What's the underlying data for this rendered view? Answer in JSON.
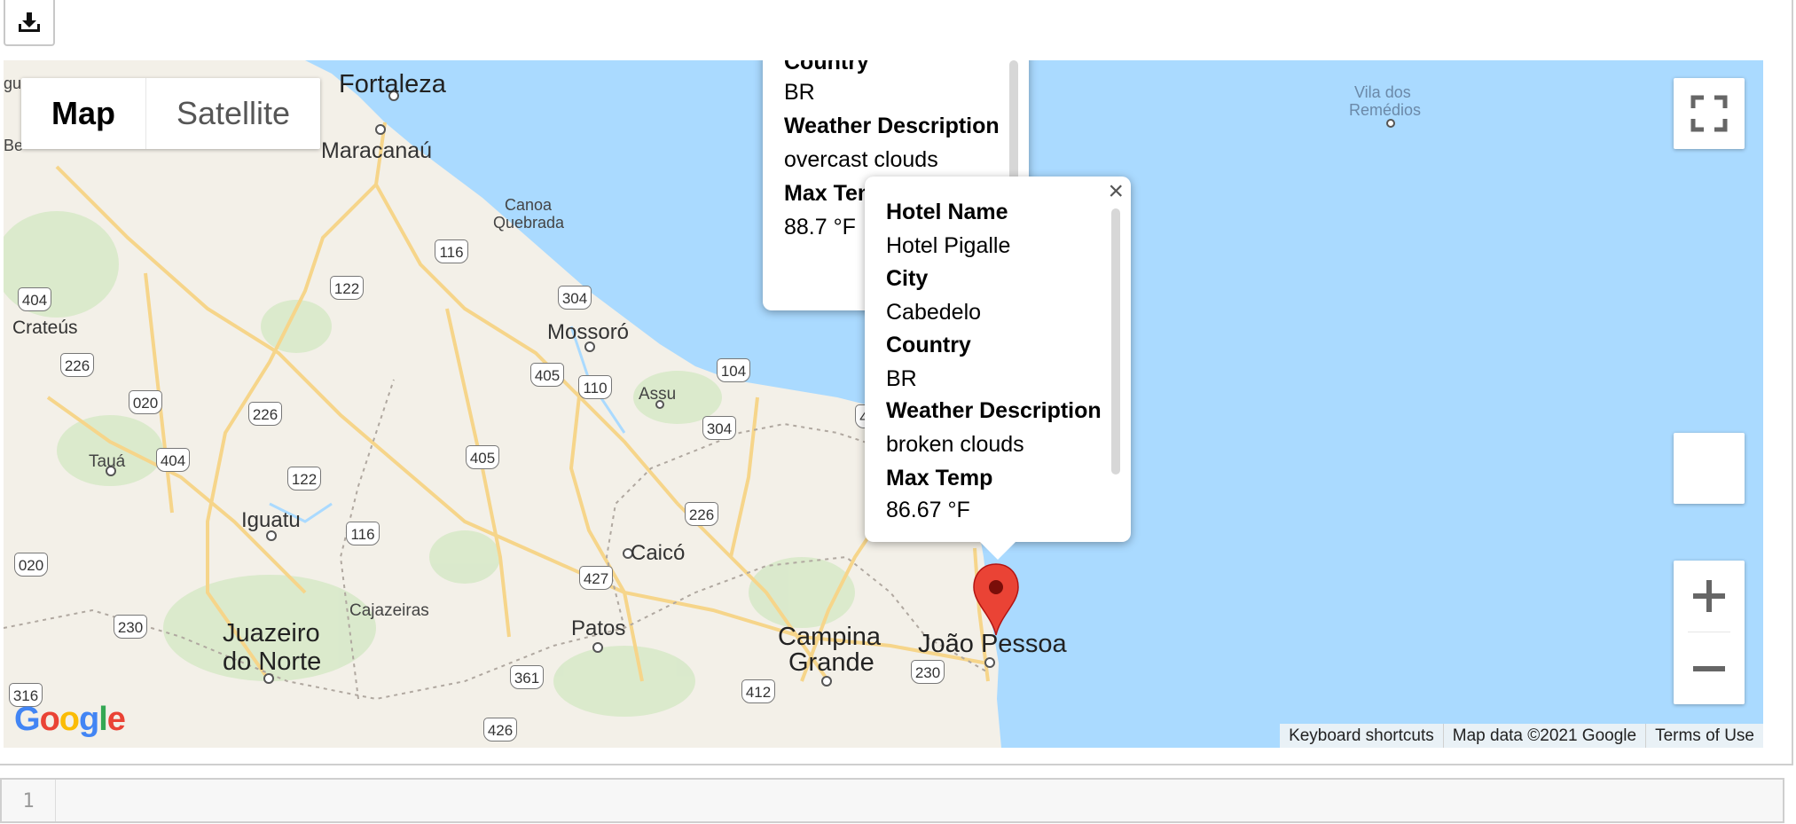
{
  "toolbar": {
    "download_icon": "download-icon"
  },
  "map": {
    "type_control": {
      "map_label": "Map",
      "satellite_label": "Satellite",
      "selected": "Map"
    },
    "controls": {
      "fullscreen_icon": "fullscreen-icon",
      "street_view_icon": "pegman-icon",
      "zoom_in_icon": "plus-icon",
      "zoom_out_icon": "minus-icon"
    },
    "places": {
      "fortaleza": "Fortaleza",
      "maracanau": "Maracanaú",
      "canoa_quebrada_1": "Canoa",
      "canoa_quebrada_2": "Quebrada",
      "vila_dos_remedios_1": "Vila dos",
      "vila_dos_remedios_2": "Remédios",
      "crateus": "Crateús",
      "mossoro": "Mossoró",
      "assu": "Assu",
      "taua": "Tauá",
      "iguatu": "Iguatu",
      "caico": "Caicó",
      "cajazeiras": "Cajazeiras",
      "juazeiro_1": "Juazeiro",
      "juazeiro_2": "do Norte",
      "patos": "Patos",
      "campina_1": "Campina",
      "campina_2": "Grande",
      "joao_pessoa": "João Pessoa",
      "edge_left": "gu",
      "edge_left_2": "Be"
    },
    "road_shields": [
      "404",
      "116",
      "122",
      "304",
      "405",
      "110",
      "104",
      "226",
      "020",
      "226",
      "404",
      "122",
      "405",
      "304",
      "226",
      "116",
      "427",
      "020",
      "230",
      "361",
      "412",
      "230",
      "316",
      "426",
      "4"
    ],
    "popups": [
      {
        "partial_top_label": "Country",
        "fields": [
          {
            "key": "",
            "value": "BR"
          },
          {
            "key": "Weather Description",
            "value": "overcast clouds"
          },
          {
            "key": "Max Temp",
            "value": "88.7 °F"
          }
        ]
      },
      {
        "close_icon": "close-icon",
        "fields": [
          {
            "key": "Hotel Name",
            "value": "Hotel Pigalle"
          },
          {
            "key": "City",
            "value": "Cabedelo"
          },
          {
            "key": "Country",
            "value": "BR"
          },
          {
            "key": "Weather Description",
            "value": "broken clouds"
          },
          {
            "key": "Max Temp",
            "value": "86.67 °F"
          }
        ]
      }
    ],
    "marker_icon": "map-pin-icon",
    "attribution": {
      "shortcuts": "Keyboard shortcuts",
      "data": "Map data ©2021 Google",
      "terms": "Terms of Use"
    },
    "logo": "Google",
    "colors": {
      "water": "#aadaff",
      "land": "#f3f0e8",
      "road": "#f6d58a",
      "marker": "#ea4335"
    }
  },
  "code_cell": {
    "line_number": "1"
  }
}
